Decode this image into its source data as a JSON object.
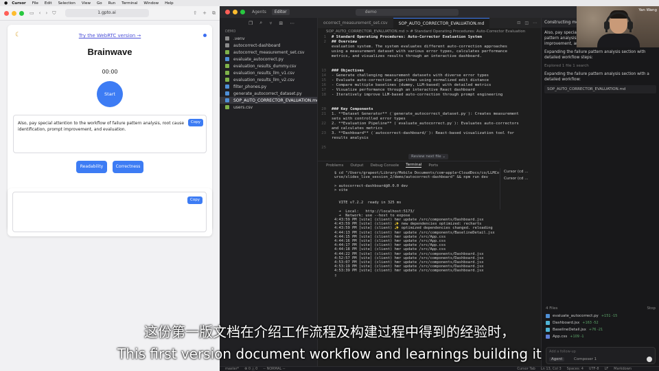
{
  "menubar": {
    "app": "Cursor",
    "items": [
      "File",
      "Edit",
      "Selection",
      "View",
      "Go",
      "Run",
      "Terminal",
      "Window",
      "Help"
    ]
  },
  "browser": {
    "url": "1.gpto.ai",
    "webrtc_link": "Try the WebRTC version →",
    "title": "Brainwave",
    "timer": "00:00",
    "start_label": "Start",
    "transcript": "Also, pay special attention to the workflow of failure pattern analysis, root cause identification, prompt improvement, and evaluation.",
    "copy_label": "Copy",
    "readability_label": "Readability",
    "correctness_label": "Correctness",
    "copy2_label": "Copy"
  },
  "editor": {
    "top_tabs": [
      "Agents",
      "Editor"
    ],
    "search": "demo",
    "explorer": {
      "section": "DEMO",
      "files": [
        {
          "name": ".venv",
          "color": "#8a8a8a"
        },
        {
          "name": "autocorrect-dashboard",
          "color": "#8a8a8a"
        },
        {
          "name": "autocorrect_measurement_set.csv",
          "color": "#7fb24a"
        },
        {
          "name": "evaluate_autocorrect.py",
          "color": "#4f8fd6"
        },
        {
          "name": "evaluation_results_dummy.csv",
          "color": "#7fb24a"
        },
        {
          "name": "evaluation_results_llm_v1.csv",
          "color": "#7fb24a"
        },
        {
          "name": "evaluation_results_llm_v2.csv",
          "color": "#7fb24a"
        },
        {
          "name": "filter_phones.py",
          "color": "#4f8fd6"
        },
        {
          "name": "generate_autocorrect_dataset.py",
          "color": "#4f8fd6"
        },
        {
          "name": "SOP_AUTO_CORRECTOR_EVALUATION.md",
          "color": "#4f8fd6",
          "active": true
        },
        {
          "name": "users.csv",
          "color": "#7fb24a"
        }
      ]
    },
    "tabs": [
      "ocorrect_measurement_set.csv",
      "SOP_AUTO_CORRECTOR_EVALUATION.md"
    ],
    "breadcrumb": "SOP_AUTO_CORRECTOR_EVALUATION.md > # Standard Operating Procedures: Auto-Corrector Evaluation",
    "code": [
      {
        "n": "1",
        "t": "# Standard Operating Procedures: Auto-Corrector Evaluation System",
        "h": true
      },
      {
        "n": "2",
        "t": "## Overview",
        "h": true
      },
      {
        "n": "",
        "t": "evaluation system. The system evaluates different auto-correction approaches"
      },
      {
        "n": "",
        "t": "using a measurement dataset with various error types, calculates performance"
      },
      {
        "n": "",
        "t": "metrics, and visualizes results through an interactive dashboard."
      },
      {
        "n": "",
        "t": ""
      },
      {
        "n": "",
        "t": ""
      },
      {
        "n": "13",
        "t": "### Objectives",
        "h": true
      },
      {
        "n": "14",
        "t": "- Generate challenging measurement datasets with diverse error types"
      },
      {
        "n": "15",
        "t": "- Evaluate auto-correction algorithms using normalized edit distance"
      },
      {
        "n": "16",
        "t": "- Compare multiple baselines (dummy, LLM-based) with detailed metrics"
      },
      {
        "n": "17",
        "t": "- Visualize performance through an interactive React dashboard"
      },
      {
        "n": "18",
        "t": "- Iteratively improve LLM-based auto-correction through prompt engineering"
      },
      {
        "n": "",
        "t": ""
      },
      {
        "n": "",
        "t": ""
      },
      {
        "n": "20",
        "t": "### Key Components",
        "h": true
      },
      {
        "n": "21",
        "t": "1. **Dataset Generator** (`generate_autocorrect_dataset.py`): Creates measurement"
      },
      {
        "n": "",
        "t": "sets with controlled error types"
      },
      {
        "n": "22",
        "t": "2. **Evaluation Pipeline** (`evaluate_autocorrect.py`): Evaluates auto-correctors"
      },
      {
        "n": "",
        "t": "and calculates metrics"
      },
      {
        "n": "23",
        "t": "3. **Dashboard** (`autocorrect-dashboard/`): React-based visualization tool for"
      },
      {
        "n": "",
        "t": "results analysis"
      },
      {
        "n": "",
        "t": ""
      },
      {
        "n": "25",
        "t": ""
      }
    ],
    "review_next": "Review next file ⌄",
    "terminal_tabs": [
      "Problems",
      "Output",
      "Debug Console",
      "Terminal",
      "Ports"
    ],
    "terminal": [
      "$ cd \"/Users/grapeot/Library/Mobile Documents/com~apple~CloudDocs/co/LLMCo",
      "urse/slides_live_session_2/demo/autocorrect-dashboard\" && npm run dev",
      "",
      "> autocorrect-dashboard@0.0.0 dev",
      "> vite",
      "",
      "",
      "  VITE v7.2.2  ready in 325 ms",
      "",
      "  ➜  Local:   http://localhost:5173/",
      "  ➜  Network: use --host to expose",
      "4:43:59 PM [vite] (client) hmr update /src/components/Dashboard.jsx",
      "4:43:59 PM [vite] (client) ✨ new dependencies optimized: recharts",
      "4:43:59 PM [vite] (client) ✨ optimized dependencies changed. reloading",
      "4:44:13 PM [vite] (client) hmr update /src/components/BaselineDetail.jsx",
      "4:44:15 PM [vite] (client) hmr update /src/App.css",
      "4:44:16 PM [vite] (client) hmr update /src/App.css",
      "4:44:17 PM [vite] (client) hmr update /src/App.css",
      "4:44:18 PM [vite] (client) hmr update /src/App.css",
      "4:44:22 PM [vite] (client) hmr update /src/components/Dashboard.jsx",
      "4:52:57 PM [vite] (client) hmr update /src/components/Dashboard.jsx",
      "4:53:07 PM [vite] (client) hmr update /src/components/Dashboard.jsx",
      "4:53:19 PM [vite] (client) hmr update /src/components/Dashboard.jsx",
      "4:53:39 PM [vite] (client) hmr update /src/components/Dashboard.jsx",
      "▯"
    ],
    "terminal_sessions": [
      "Cursor (cd ...",
      "Cursor (cd ..."
    ],
    "chat": {
      "header": "Constructing measure",
      "p1": "Also, pay special attention to the workflow of failure pattern analysis, root cause identification, prompt improvement, and evaluation.",
      "p2": "Expanding the failure pattern analysis section with detailed workflow steps:",
      "explored": "Explored 1 file 1 search",
      "p3": "Expanding the failure pattern analysis section with a detailed workflow:",
      "file_ref": "SOP_AUTO_CORRECTOR_EVALUATION.md",
      "files_head": "4 Files",
      "stop_label": "Stop",
      "files": [
        {
          "name": "evaluate_autocorrect.py",
          "diff": "+151 -15",
          "color": "#4f8fd6"
        },
        {
          "name": "Dashboard.jsx",
          "diff": "+163 -52",
          "color": "#4fb3d6"
        },
        {
          "name": "BaselineDetail.jsx",
          "diff": "+76 -21",
          "color": "#4fb3d6"
        },
        {
          "name": "App.css",
          "diff": "+109 -1",
          "color": "#5f7fd6"
        }
      ],
      "input_placeholder": "Add a follow-up",
      "agent_label": "Agent",
      "model_label": "Composer 1"
    },
    "status_left": [
      "master*",
      "⊗ 0 △ 0",
      "-- NORMAL --"
    ],
    "status_right": [
      "Cursor Tab",
      "Ln 13, Col 3",
      "Spaces: 4",
      "UTF-8",
      "LF",
      "Markdown"
    ]
  },
  "webcam": {
    "name": "Yan Wang"
  },
  "subtitles": {
    "zh": "这份第一版文档在介绍工作流程及构建过程中得到的经验时，",
    "en": "This first version document workflow and learnings building it"
  },
  "colors": {
    "accent": "#3d7cf4",
    "editor_bg": "#1e1e1e"
  }
}
